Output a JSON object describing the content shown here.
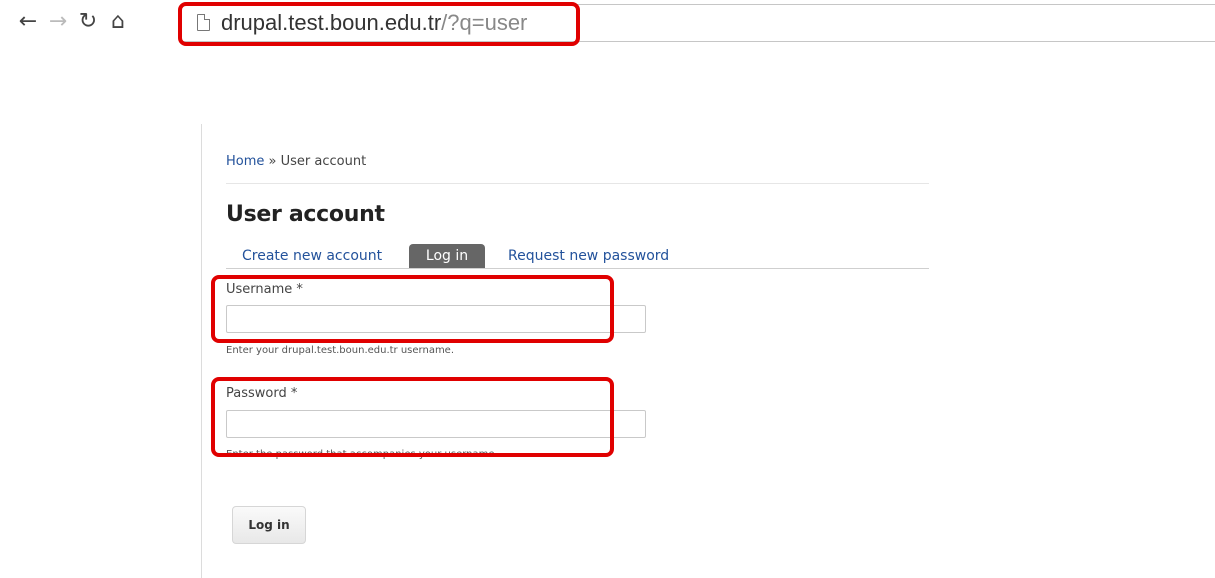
{
  "browser": {
    "url_host": "drupal.test.boun.edu.tr",
    "url_path": "/?q=user",
    "icons": {
      "back": "back-arrow-icon",
      "forward": "forward-arrow-icon",
      "reload": "reload-icon",
      "home": "home-icon",
      "page": "page-icon"
    },
    "highlight_color": "#e00000"
  },
  "breadcrumb": {
    "home": "Home",
    "separator": " » ",
    "current": "User account"
  },
  "page_title": "User account",
  "tabs": [
    {
      "label": "Create new account",
      "active": false
    },
    {
      "label": "Log in",
      "active": true
    },
    {
      "label": "Request new password",
      "active": false
    }
  ],
  "form": {
    "username": {
      "label": "Username",
      "required_marker": "*",
      "value": "",
      "description": "Enter your drupal.test.boun.edu.tr username."
    },
    "password": {
      "label": "Password",
      "required_marker": "*",
      "value": "",
      "description": "Enter the password that accompanies your username."
    },
    "submit_label": "Log in"
  },
  "colors": {
    "link": "#23529b",
    "active_tab_bg": "#666666",
    "highlight": "#e00000"
  }
}
